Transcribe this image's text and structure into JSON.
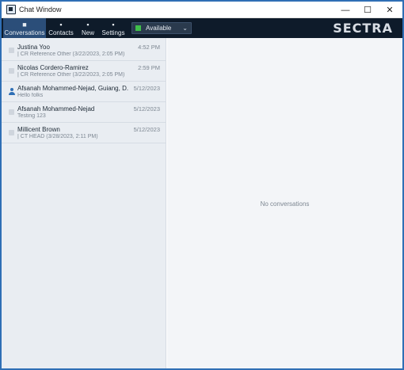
{
  "window": {
    "title": "Chat Window",
    "controls": {
      "minimize": "—",
      "maximize": "☐",
      "close": "✕"
    }
  },
  "toolbar": {
    "items": [
      {
        "label": "Conversations",
        "icon": "conversations-icon",
        "glyph": "■"
      },
      {
        "label": "Contacts",
        "icon": "contacts-icon",
        "glyph": "▪"
      },
      {
        "label": "New",
        "icon": "new-conversation-icon",
        "glyph": "▪"
      },
      {
        "label": "Settings",
        "icon": "settings-icon",
        "glyph": "▪"
      }
    ],
    "status": {
      "value": "Available",
      "color": "#3fbf4a"
    },
    "brand": "SECTRA"
  },
  "conversations": [
    {
      "name": "Justina Yoo",
      "preview": "| CR Reference Other (3/22/2023, 2:05 PM)",
      "time": "4:52 PM",
      "icon": "message-icon"
    },
    {
      "name": "Nicolas Cordero-Ramirez",
      "preview": "| CR Reference Other (3/22/2023, 2:05 PM)",
      "time": "2:59 PM",
      "icon": "message-icon"
    },
    {
      "name": "Afsanah Mohammed-Nejad, Guiang, D...",
      "preview": "Hello folks",
      "time": "5/12/2023",
      "icon": "group-person-icon"
    },
    {
      "name": "Afsanah Mohammed-Nejad",
      "preview": "Testing 123",
      "time": "5/12/2023",
      "icon": "message-icon"
    },
    {
      "name": "Millicent Brown",
      "preview": "| CT HEAD (3/28/2023, 2:11 PM)",
      "time": "5/12/2023",
      "icon": "message-icon"
    }
  ],
  "main": {
    "empty_message": "No conversations"
  },
  "colors": {
    "toolbar_bg": "#0e1b2a",
    "active_tab": "#2b4e79",
    "border": "#2f6fb5"
  }
}
